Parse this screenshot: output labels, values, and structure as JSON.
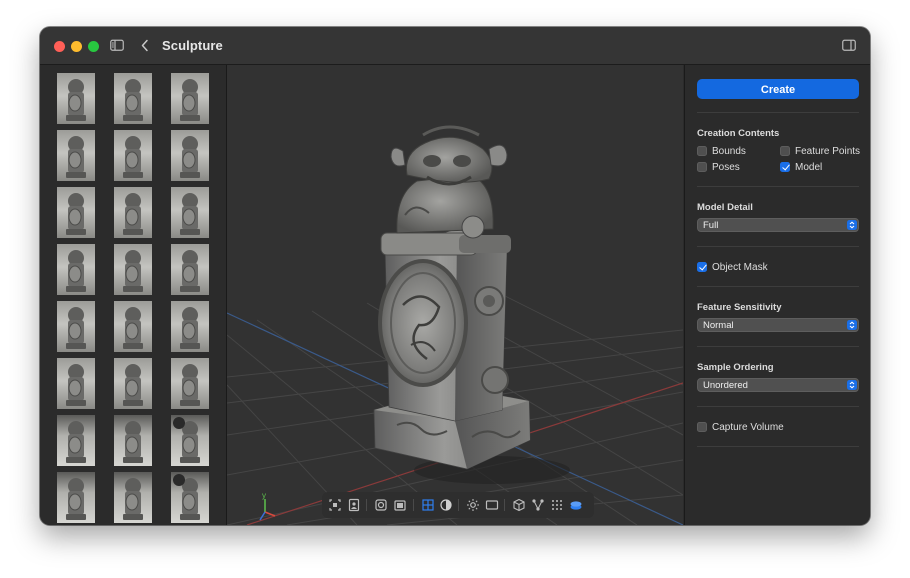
{
  "window": {
    "title": "Sculpture"
  },
  "titlebar": {
    "sidebar_toggle_icon": "sidebar-left-icon",
    "back_icon": "chevron-left-icon",
    "inspector_toggle_icon": "sidebar-right-icon"
  },
  "gallery": {
    "columns": 3,
    "rows": 8
  },
  "viewport": {
    "axis_labels": {
      "y": "y"
    },
    "toolbar": [
      {
        "name": "frame-selection-icon"
      },
      {
        "name": "image-frame-icon"
      },
      {
        "name": "target-icon"
      },
      {
        "name": "photo-stack-icon"
      },
      {
        "name": "grid-icon",
        "active": true
      },
      {
        "name": "contrast-icon"
      },
      {
        "name": "sun-icon"
      },
      {
        "name": "rectangle-icon"
      },
      {
        "name": "cube-icon"
      },
      {
        "name": "graph-nodes-icon"
      },
      {
        "name": "dots-grid-icon"
      },
      {
        "name": "layers-icon",
        "active": true
      }
    ]
  },
  "inspector": {
    "create_label": "Create",
    "creation_contents": {
      "title": "Creation Contents",
      "bounds": {
        "label": "Bounds",
        "checked": false
      },
      "feature_points": {
        "label": "Feature Points",
        "checked": false
      },
      "poses": {
        "label": "Poses",
        "checked": false
      },
      "model": {
        "label": "Model",
        "checked": true
      }
    },
    "model_detail": {
      "title": "Model Detail",
      "value": "Full"
    },
    "object_mask": {
      "label": "Object Mask",
      "checked": true
    },
    "feature_sensitivity": {
      "title": "Feature Sensitivity",
      "value": "Normal"
    },
    "sample_ordering": {
      "title": "Sample Ordering",
      "value": "Unordered"
    },
    "capture_volume": {
      "label": "Capture Volume",
      "checked": false
    }
  },
  "colors": {
    "accent": "#1a6fe8",
    "button": "#1469e0",
    "background": "#2b2b2b",
    "viewport": "#323232"
  }
}
